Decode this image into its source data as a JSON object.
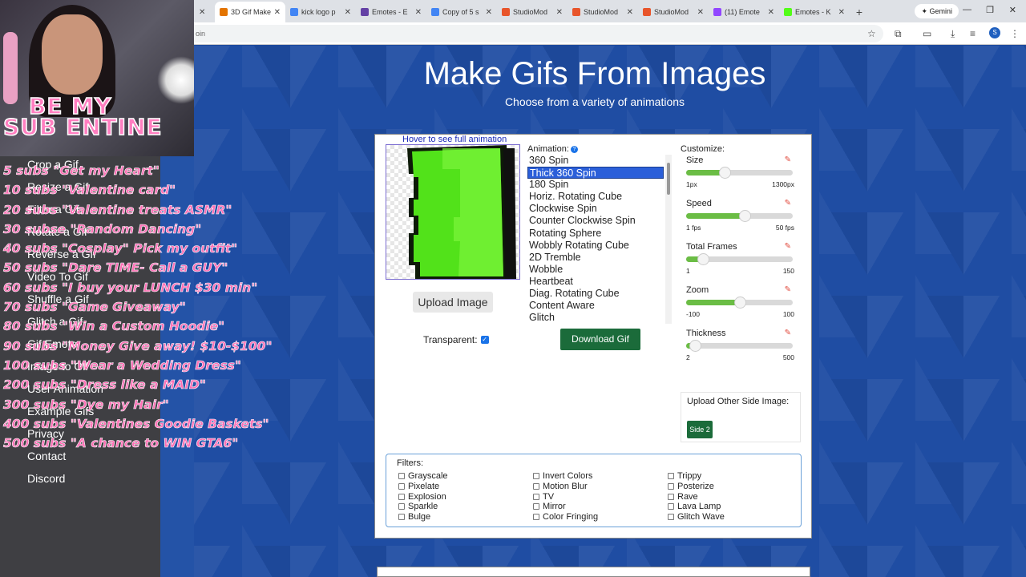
{
  "browser": {
    "tabs": [
      {
        "title": "3D Gif Maker",
        "active": true,
        "color": "#e37400"
      },
      {
        "title": "kick logo p",
        "active": false,
        "color": "#4285f4"
      },
      {
        "title": "Emotes - E",
        "active": false,
        "color": "#6441a5"
      },
      {
        "title": "Copy of 5 s",
        "active": false,
        "color": "#4285f4"
      },
      {
        "title": "StudioMod",
        "active": false,
        "color": "#e8552b"
      },
      {
        "title": "StudioMod",
        "active": false,
        "color": "#e8552b"
      },
      {
        "title": "StudioMod",
        "active": false,
        "color": "#e8552b"
      },
      {
        "title": "(11) Emote",
        "active": false,
        "color": "#9146ff"
      },
      {
        "title": "Emotes - K",
        "active": false,
        "color": "#53fc18"
      }
    ],
    "new_tab": "+",
    "gemini_label": "Gemini",
    "address_fragment": "oin",
    "profile_letter": "S"
  },
  "overlay": {
    "banner_line1": "BE MY",
    "banner_line2": "SUB ENTINE",
    "goals": [
      "5 subs \"Get my Heart\"",
      "10 subs \"Valentine card\"",
      "20 subs \"Valentine treats ASMR\"",
      "30 subse \"Random Dancing\"",
      "40 subs \"Cosplay\" Pick my outfit\"",
      "50 subs \"Dare TIME- Call a GUY\"",
      "60 subs \"I buy your LUNCH $30 min\"",
      "70 subs \"Game Giveaway\"",
      "80 subs \"Win a Custom Hoodie\"",
      "90 subs \"Money Give away! $10-$100\"",
      "100 subs \"Wear a Wedding Dress\"",
      "200 subs \"Dress like a MAID\"",
      "300 subs \"Dye my Hair\"",
      "400 subs \"Valentines Goodie Baskets\"",
      "500 subs \"A chance to WIN GTA6\""
    ]
  },
  "sidebar": {
    "items": [
      "Crop a Gif",
      "Resize a Gif",
      "Filter a Gif",
      "Rotate a Gif",
      "Reverse a Gif",
      "Video To Gif",
      "Shuffle a Gif",
      "Glitch a Gif",
      "Gif Emote",
      "Image to Gif",
      "User Animation",
      "Example Gifs",
      "Privacy",
      "Contact",
      "Discord"
    ]
  },
  "header": {
    "title": "Make Gifs From Images",
    "subtitle": "Choose from a variety of animations"
  },
  "preview": {
    "hint": "Hover to see full animation",
    "upload_label": "Upload Image",
    "transparent_label": "Transparent:",
    "transparent_checked": true
  },
  "animation": {
    "label": "Animation:",
    "items": [
      "360 Spin",
      "Thick 360 Spin",
      "180 Spin",
      "Horiz. Rotating Cube",
      "Clockwise Spin",
      "Counter Clockwise Spin",
      "Rotating Sphere",
      "Wobbly Rotating Cube",
      "2D Tremble",
      "Wobble",
      "Heartbeat",
      "Diag. Rotating Cube",
      "Content Aware",
      "Glitch"
    ],
    "selected": "Thick 360 Spin",
    "download_label": "Download Gif"
  },
  "customize": {
    "label": "Customize:",
    "sliders": [
      {
        "name": "Size",
        "min_label": "1px",
        "max_label": "1300px",
        "value_fraction": 0.36
      },
      {
        "name": "Speed",
        "min_label": "1 fps",
        "max_label": "50 fps",
        "value_fraction": 0.55
      },
      {
        "name": "Total Frames",
        "min_label": "1",
        "max_label": "150",
        "value_fraction": 0.16
      },
      {
        "name": "Zoom",
        "min_label": "-100",
        "max_label": "100",
        "value_fraction": 0.5
      },
      {
        "name": "Thickness",
        "min_label": "2",
        "max_label": "500",
        "value_fraction": 0.08
      }
    ],
    "other_side_label": "Upload Other Side Image:",
    "side2_label": "Side 2"
  },
  "filters": {
    "label": "Filters:",
    "columns": [
      [
        "Grayscale",
        "Pixelate",
        "Explosion",
        "Sparkle",
        "Bulge"
      ],
      [
        "Invert Colors",
        "Motion Blur",
        "TV",
        "Mirror",
        "Color Fringing"
      ],
      [
        "Trippy",
        "Posterize",
        "Rave",
        "Lava Lamp",
        "Glitch Wave"
      ]
    ]
  }
}
